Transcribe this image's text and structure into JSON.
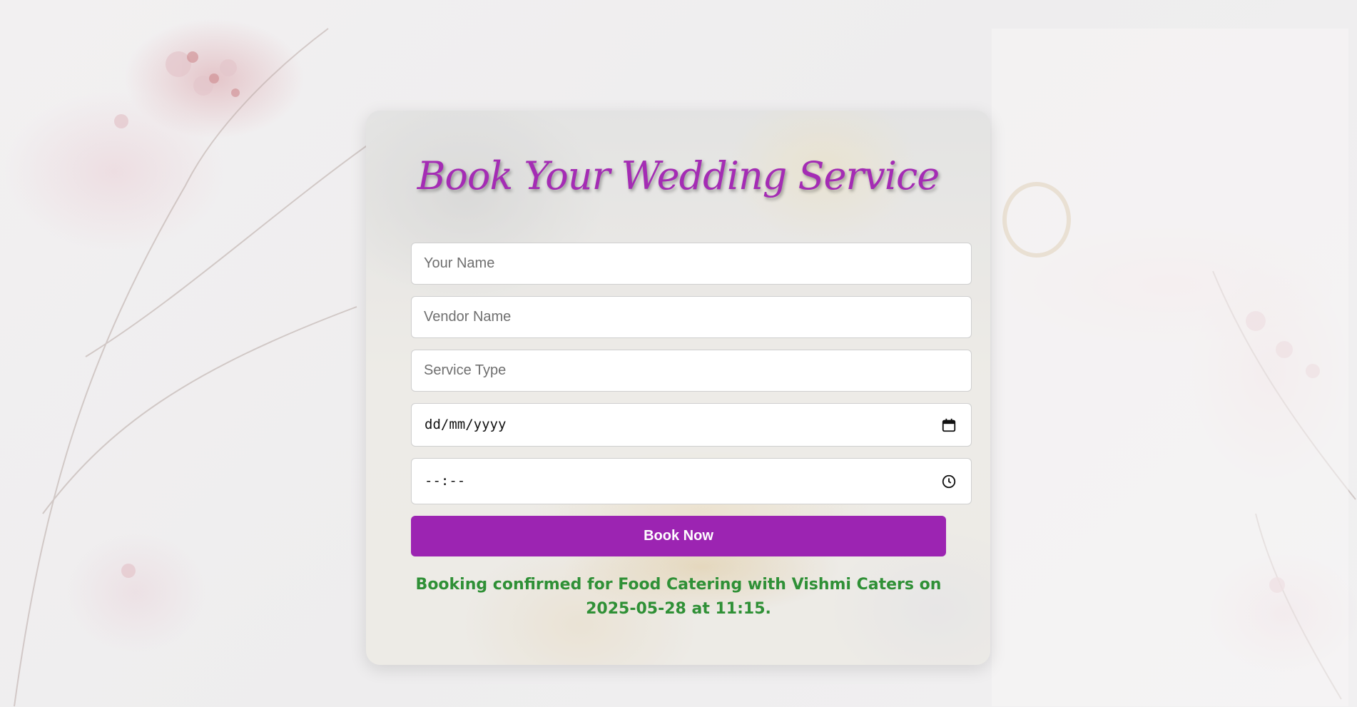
{
  "page": {
    "title": "Book Your Wedding Service",
    "accent_color": "#9c24b2",
    "success_color": "#2f9036"
  },
  "form": {
    "your_name": {
      "placeholder": "Your Name",
      "value": ""
    },
    "vendor_name": {
      "placeholder": "Vendor Name",
      "value": ""
    },
    "service_type": {
      "placeholder": "Service Type",
      "value": ""
    },
    "date": {
      "display": "dd/mm/yyyy",
      "icon": "calendar-icon"
    },
    "time": {
      "display": "--:--",
      "icon": "clock-icon"
    },
    "submit_label": "Book Now"
  },
  "message": {
    "text": "Booking confirmed for Food Catering with Vishmi Caters on 2025-05-28 at 11:15."
  }
}
